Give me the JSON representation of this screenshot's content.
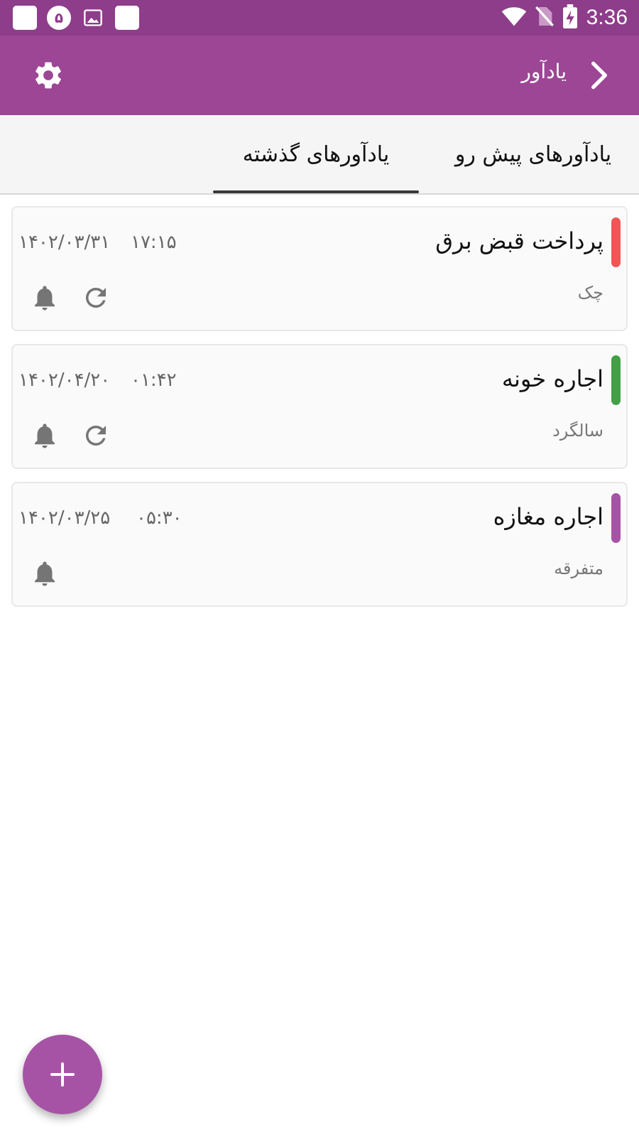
{
  "status_bar": {
    "notification_badge": "۵",
    "time": "3:36",
    "icons": [
      "app-square-icon",
      "badge-circle-icon",
      "image-icon",
      "app-square-icon",
      "wifi-icon",
      "no-sim-icon",
      "battery-charging-icon"
    ]
  },
  "app_bar": {
    "title": "یادآور",
    "icons": {
      "settings": "gear-icon",
      "back": "chevron-right-icon"
    }
  },
  "tabs": [
    {
      "label": "یادآورهای پیش رو",
      "active": false
    },
    {
      "label": "یادآورهای گذشته",
      "active": true
    }
  ],
  "reminders": [
    {
      "title": "پرداخت قبض برق",
      "category": "چک",
      "time": "۱۷:۱۵",
      "date": "۱۴۰۲/۰۳/۳۱",
      "color": "#f25555",
      "repeat": true
    },
    {
      "title": "اجاره خونه",
      "category": "سالگرد",
      "time": "۰۱:۴۲",
      "date": "۱۴۰۲/۰۴/۲۰",
      "color": "#43a047",
      "repeat": true
    },
    {
      "title": "اجاره مغازه",
      "category": "متفرقه",
      "time": "۰۵:۳۰",
      "date": "۱۴۰۲/۰۳/۲۵",
      "color": "#a653a6",
      "repeat": false
    }
  ],
  "fab": {
    "icon": "plus-icon"
  },
  "colors": {
    "status_bar": "#8e3d8a",
    "app_bar": "#9c4695",
    "fab": "#a653a6"
  }
}
